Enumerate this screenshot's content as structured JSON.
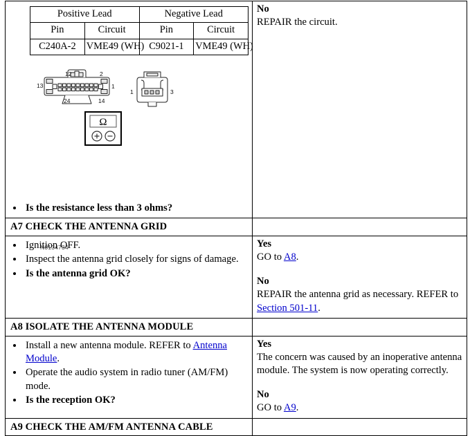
{
  "document": {
    "type": "pinpoint-test-table",
    "figure_id": "N0134734"
  },
  "pin_table": {
    "group_headers": [
      "Positive Lead",
      "Negative Lead"
    ],
    "column_headers": [
      "Pin",
      "Circuit",
      "Pin",
      "Circuit"
    ],
    "rows": [
      [
        "C240A-2",
        "VME49 (WH)",
        "C9021-1",
        "VME49 (WH)"
      ]
    ]
  },
  "figure": {
    "id_label": "N0134734",
    "connector_24pin": {
      "pin_labels": [
        "12",
        "2",
        "13",
        "1",
        "24",
        "14"
      ]
    },
    "connector_3pin": {
      "pin_labels": [
        "1",
        "3"
      ]
    },
    "meter": {
      "mode_symbol": "Ω",
      "positive_terminal": "+",
      "negative_terminal": "−"
    }
  },
  "step_a6_continued": {
    "left_bullets": [
      {
        "text": "Is the resistance less than 3 ohms?",
        "bold": true
      }
    ],
    "right": {
      "no_label": "No",
      "no_text": "REPAIR the circuit."
    }
  },
  "step_a7": {
    "header": "A7 CHECK THE ANTENNA GRID",
    "bullets": [
      {
        "text": "Ignition OFF.",
        "bold": false
      },
      {
        "text": "Inspect the antenna grid closely for signs of damage.",
        "bold": false
      },
      {
        "text": "Is the antenna grid OK?",
        "bold": true
      }
    ],
    "right": {
      "yes_label": "Yes",
      "yes_prefix": "GO to ",
      "yes_link": "A8",
      "yes_suffix": ".",
      "no_label": "No",
      "no_prefix": "REPAIR the antenna grid as necessary. REFER to ",
      "no_link": "Section 501-11",
      "no_suffix": "."
    }
  },
  "step_a8": {
    "header": "A8 ISOLATE THE ANTENNA MODULE",
    "bullets": [
      {
        "prefix": "Install a new antenna module. REFER to ",
        "link": "Antenna Module",
        "suffix": ".",
        "bold": false
      },
      {
        "text": "Operate the audio system in radio tuner (AM/FM) mode.",
        "bold": false
      },
      {
        "text": "Is the reception OK?",
        "bold": true
      }
    ],
    "right": {
      "yes_label": "Yes",
      "yes_text": "The concern was caused by an inoperative antenna module. The system is now operating correctly.",
      "no_label": "No",
      "no_prefix": "GO to ",
      "no_link": "A9",
      "no_suffix": "."
    }
  },
  "step_a9": {
    "header": "A9 CHECK THE AM/FM ANTENNA CABLE"
  },
  "colors": {
    "link": "#0000CC",
    "border": "#000000",
    "text": "#000000"
  }
}
